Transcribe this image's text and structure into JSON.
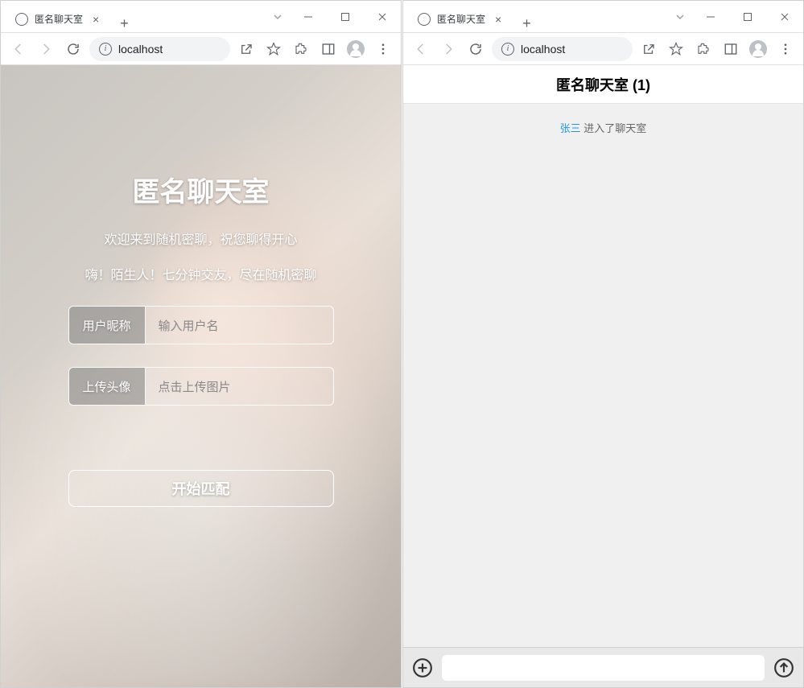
{
  "left": {
    "tab_title": "匿名聊天室",
    "address": "localhost",
    "hero_title": "匿名聊天室",
    "hero_sub1": "欢迎来到随机密聊，祝您聊得开心",
    "hero_sub2": "嗨！陌生人！七分钟交友，尽在随机密聊",
    "nickname_label": "用户昵称",
    "nickname_placeholder": "输入用户名",
    "avatar_label": "上传头像",
    "avatar_placeholder": "点击上传图片",
    "match_button": "开始匹配"
  },
  "right": {
    "tab_title": "匿名聊天室",
    "address": "localhost",
    "header": "匿名聊天室 (1)",
    "system_user": "张三",
    "system_action": " 进入了聊天室"
  }
}
